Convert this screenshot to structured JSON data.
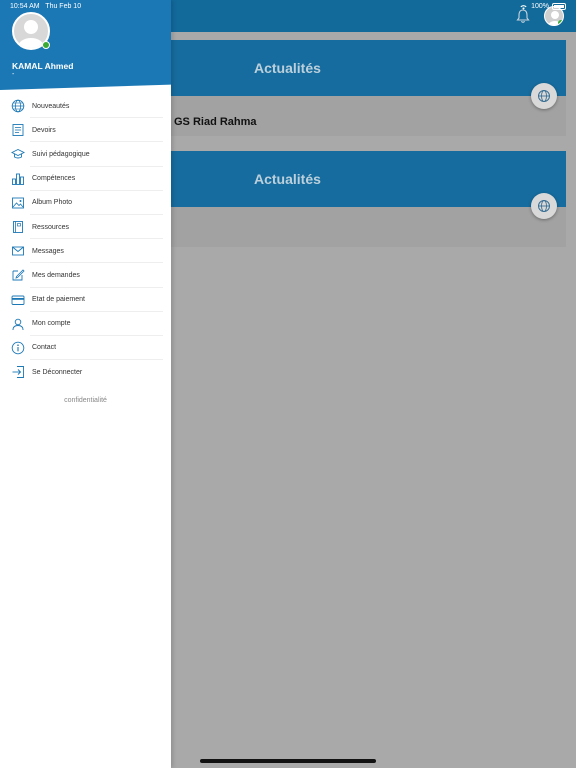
{
  "status": {
    "time": "10:54 AM",
    "date": "Thu Feb 10",
    "battery": "100%"
  },
  "profile": {
    "name": "KAMAL Ahmed",
    "subtitle": "-"
  },
  "menu": [
    {
      "label": "Nouveautés",
      "icon": "globe-icon"
    },
    {
      "label": "Devoirs",
      "icon": "document-icon"
    },
    {
      "label": "Suivi pédagogique",
      "icon": "graduation-cap-icon"
    },
    {
      "label": "Compétences",
      "icon": "bar-chart-icon"
    },
    {
      "label": "Album Photo",
      "icon": "photo-icon"
    },
    {
      "label": "Ressources",
      "icon": "book-icon"
    },
    {
      "label": "Messages",
      "icon": "envelope-icon"
    },
    {
      "label": "Mes demandes",
      "icon": "edit-icon"
    },
    {
      "label": "Etat de paiement",
      "icon": "credit-card-icon"
    },
    {
      "label": "Mon compte",
      "icon": "user-icon"
    },
    {
      "label": "Contact",
      "icon": "info-icon"
    },
    {
      "label": "Se Déconnecter",
      "icon": "logout-icon"
    }
  ],
  "footer": {
    "confidential": "confidentialité"
  },
  "cards": [
    {
      "title": "Actualités",
      "text": "GS Riad Rahma"
    },
    {
      "title": "Actualités",
      "text": ""
    }
  ],
  "colors": {
    "primary": "#1c78b5",
    "online": "#3aaa35"
  }
}
